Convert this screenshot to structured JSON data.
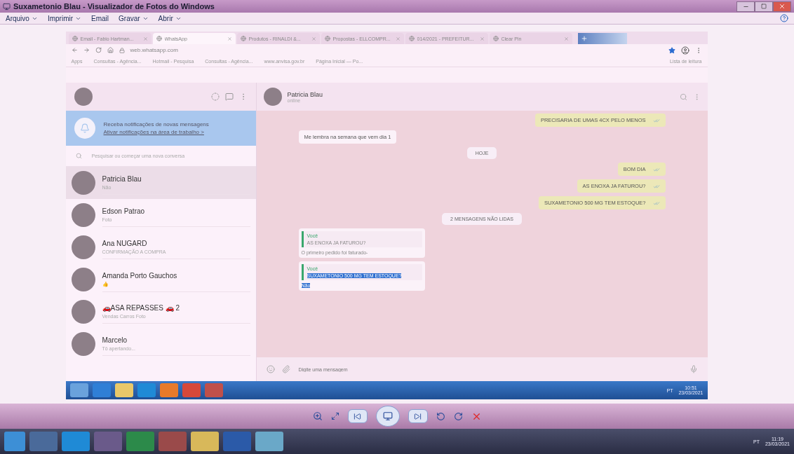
{
  "window": {
    "title": "Suxametonio Blau - Visualizador de Fotos do Windows"
  },
  "menu": [
    {
      "label": "Arquivo",
      "dropdown": true
    },
    {
      "label": "Imprimir",
      "dropdown": true
    },
    {
      "label": "Email",
      "dropdown": false
    },
    {
      "label": "Gravar",
      "dropdown": true
    },
    {
      "label": "Abrir",
      "dropdown": true
    }
  ],
  "photo": {
    "browser": {
      "tabs": [
        {
          "label": "Email - Fabio Hartman...",
          "selected": false
        },
        {
          "label": "WhatsApp",
          "selected": true
        },
        {
          "label": "Produtos - RINALDI &...",
          "selected": false
        },
        {
          "label": "Propostas - ELLCOMPR...",
          "selected": false
        },
        {
          "label": "014/2021 - PREFEITUR...",
          "selected": false
        },
        {
          "label": "Clear Pin",
          "selected": false
        }
      ],
      "url": "web.whatsapp.com",
      "bookmarks": [
        "Apps",
        "Consultas - Agência...",
        "Hotmail - Pesquisa",
        "Consultas - Agência...",
        "www.anvisa.gov.br",
        "Página Inicial — Po..."
      ],
      "reading_list": "Lista de leitura"
    },
    "whatsapp": {
      "banner": {
        "title": "Receba notificações de novas mensagens",
        "link": "Ativar notificações na área de trabalho >"
      },
      "search": {
        "placeholder": "Pesquisar ou começar uma nova conversa"
      },
      "chats": [
        {
          "name": "Patricia Blau",
          "preview": "Não",
          "selected": true
        },
        {
          "name": "Edson Patrao",
          "preview": "Foto",
          "selected": false
        },
        {
          "name": "Ana NUGARD",
          "preview": "CONFIRMAÇÃO A COMPRA",
          "selected": false
        },
        {
          "name": "Amanda Porto Gauchos",
          "preview": "👍",
          "selected": false
        },
        {
          "name": "🚗ASA REPASSES 🚗 2",
          "preview": "Vendas Carros Foto",
          "selected": false
        },
        {
          "name": "Marcelo",
          "preview": "Tô apertando...",
          "selected": false
        }
      ],
      "contact": {
        "name": "Patricia Blau",
        "status": "online"
      },
      "messages": [
        {
          "kind": "out",
          "text": "PRECISARIA DE UMAS 4CX PELO MENOS"
        },
        {
          "kind": "in",
          "text": "Me lembra na semana que vem dia 1"
        },
        {
          "kind": "divider",
          "text": "HOJE"
        },
        {
          "kind": "out",
          "text": "BOM DIA"
        },
        {
          "kind": "out",
          "text": "AS ENOXA JA FATUROU?"
        },
        {
          "kind": "out",
          "text": "SUXAMETONIO 500 MG TEM ESTOQUE?"
        },
        {
          "kind": "divider",
          "text": "2 MENSAGENS NÃO LIDAS"
        },
        {
          "kind": "reply",
          "author": "Você",
          "quote": "AS ENOXA JA FATUROU?",
          "text": "O primeiro pedido foi faturado-",
          "selected": false
        },
        {
          "kind": "reply",
          "author": "Você",
          "quote": "SUXAMETONIO 500 MG TEM ESTOQUE?",
          "text": "Não",
          "selected": true
        }
      ],
      "input": {
        "placeholder": "Digite uma mensagem"
      }
    },
    "taskbar": {
      "language": "PT",
      "time": "10:51",
      "date": "23/03/2021"
    }
  },
  "taskbar": {
    "language": "PT",
    "time": "11:19",
    "date": "23/03/2021"
  }
}
